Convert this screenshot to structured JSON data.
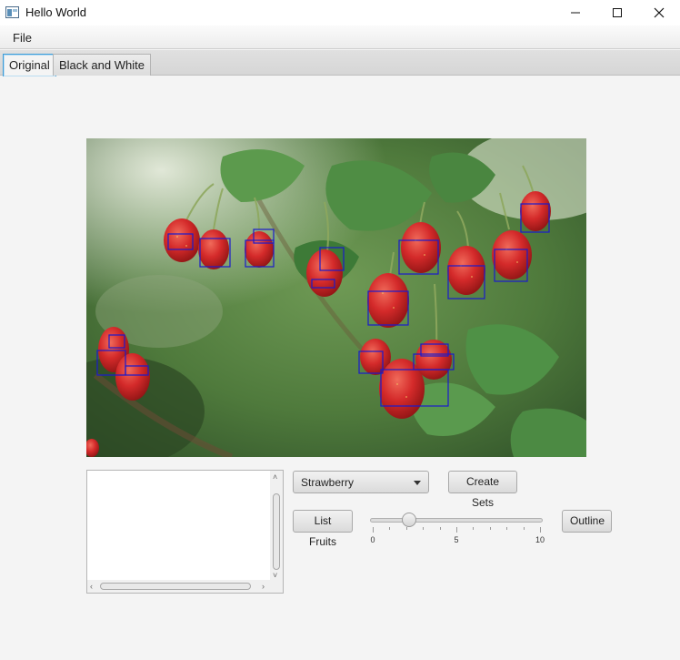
{
  "window": {
    "title": "Hello World"
  },
  "menu": {
    "file_label": "File"
  },
  "tabs": [
    {
      "label": "Original",
      "selected": true
    },
    {
      "label": "Black and White",
      "selected": false
    }
  ],
  "controls": {
    "fruit_select": {
      "value": "Strawberry"
    },
    "create_sets_label": "Create Sets",
    "list_fruits_label": "List Fruits",
    "outline_label": "Outline",
    "slider": {
      "min": 0,
      "max": 10,
      "value": 2.2,
      "major_labels": [
        "0",
        "5",
        "10"
      ]
    }
  },
  "listview": {
    "items": []
  },
  "colors": {
    "detection_box": "#1a1acc",
    "tab_focus": "#3c9cd8",
    "strawberry": "#d42a2a",
    "leaf": "#3f7a3a"
  }
}
